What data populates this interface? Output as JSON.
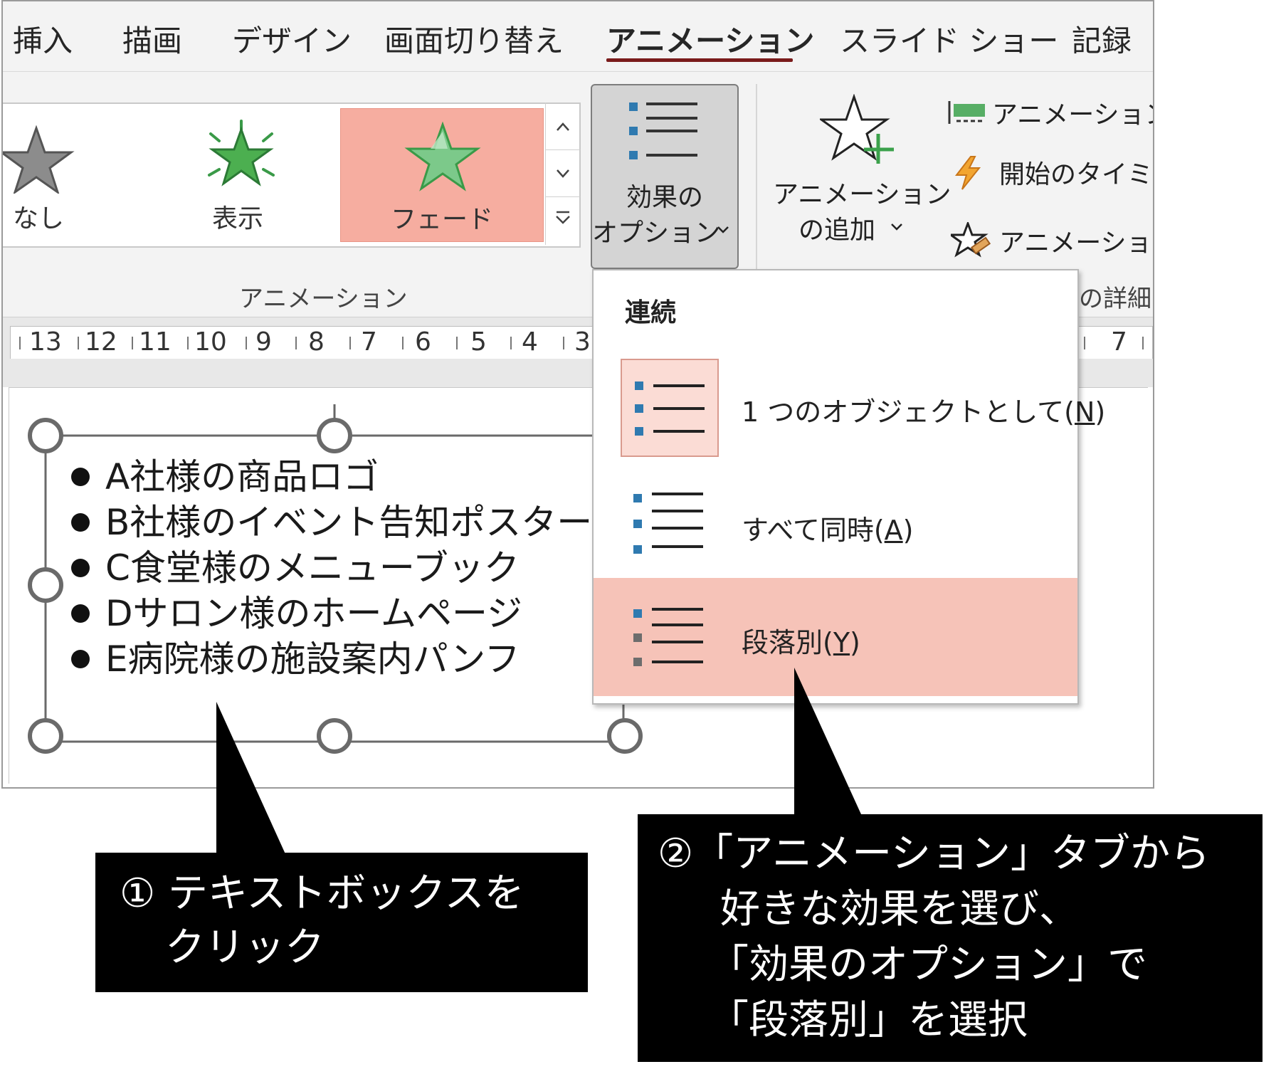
{
  "tabs": [
    "挿入",
    "描画",
    "デザイン",
    "画面切り替え",
    "アニメーション",
    "スライド ショー",
    "記録"
  ],
  "active_tab": "アニメーション",
  "gallery": {
    "items": [
      {
        "label": "なし",
        "icon": "star-none-icon"
      },
      {
        "label": "表示",
        "icon": "star-appear-icon"
      },
      {
        "label": "フェード",
        "icon": "star-fade-icon",
        "selected": true
      }
    ],
    "scroll": {
      "up": "^",
      "down": "v",
      "more": "▾"
    }
  },
  "effect_options": {
    "line1": "効果の",
    "line2": "オプション",
    "chevron": "⌄"
  },
  "add_animation": {
    "line1": "アニメーション",
    "line2": "の追加",
    "chevron": "⌄"
  },
  "advanced": {
    "items": [
      "アニメーション",
      "開始のタイミン",
      "アニメーション"
    ],
    "group_label_fragment": "の詳細"
  },
  "group_label": "アニメーション",
  "ruler": {
    "numbers": [
      "13",
      "12",
      "11",
      "10",
      "9",
      "8",
      "7",
      "6",
      "5",
      "4",
      "3",
      "7"
    ]
  },
  "textbox": {
    "lines": [
      "A社様の商品ロゴ",
      "B社様のイベント告知ポスター",
      "C食堂様のメニューブック",
      "Dサロン様のホームページ",
      "E病院様の施設案内パンフ"
    ]
  },
  "dropdown": {
    "header": "連続",
    "items": [
      {
        "label_text": "1 つのオブジェクトとして(",
        "accel": "N",
        "suffix": ")",
        "state": "current"
      },
      {
        "label_text": "すべて同時(",
        "accel": "A",
        "suffix": ")",
        "state": "normal"
      },
      {
        "label_text": "段落別(",
        "accel": "Y",
        "suffix": ")",
        "state": "hover"
      }
    ]
  },
  "callouts": {
    "c1_line1": "① テキストボックスを",
    "c1_line2": "クリック",
    "c2_line1": "②「アニメーション」タブから",
    "c2_line2": "好きな効果を選び、",
    "c2_line3": "「効果のオプション」で",
    "c2_line4": "「段落別」を選択"
  },
  "colors": {
    "accent_underline": "#7a1b1b",
    "selected_bg": "#f6ada0",
    "hover_bg": "#f6c3b8",
    "bullet_blue": "#2f7ab0",
    "bullet_gray": "#6d6d6d",
    "star_green": "#3ba14b"
  }
}
